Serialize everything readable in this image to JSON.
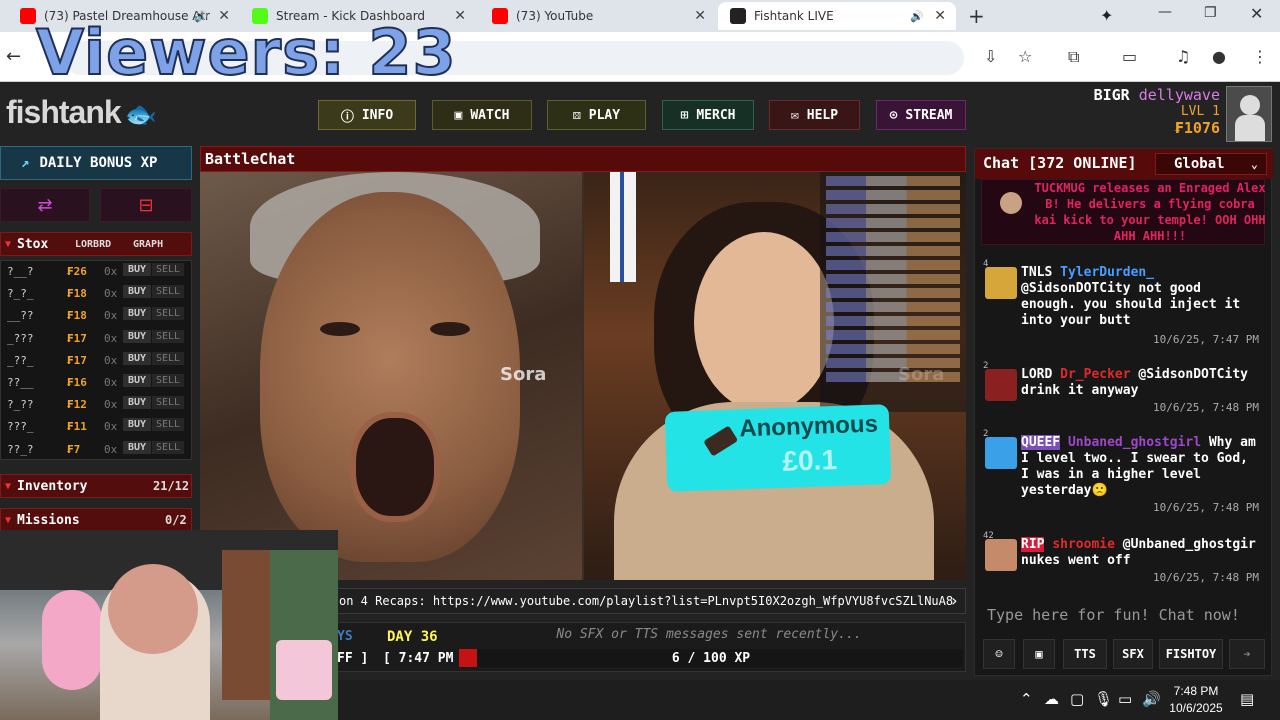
{
  "browser": {
    "tabs": [
      {
        "title": "(73) Pastel Dreamhouse Atr",
        "favicon_color": "#ff0000",
        "active": false,
        "audio": true
      },
      {
        "title": "Stream - Kick Dashboard",
        "favicon_color": "#53fc18",
        "active": false,
        "audio": false
      },
      {
        "title": "(73) YouTube",
        "favicon_color": "#ff0000",
        "active": false,
        "audio": false
      },
      {
        "title": "Fishtank LIVE",
        "favicon_color": "#222222",
        "active": true,
        "audio": true
      }
    ],
    "new_tab": "+"
  },
  "overlay": {
    "viewers": "Viewers: 23"
  },
  "site": {
    "logo": "fishtank",
    "nav": [
      {
        "label": "INFO",
        "icon": "info-icon",
        "glyph": "ⓘ",
        "color": "#3b3a1a",
        "border": "#6d6a32"
      },
      {
        "label": "WATCH",
        "icon": "camera-icon",
        "glyph": "▣",
        "color": "#2e2e16",
        "border": "#5d5b2b"
      },
      {
        "label": "PLAY",
        "icon": "dice-icon",
        "glyph": "⚄",
        "color": "#2e3016",
        "border": "#5b6030"
      },
      {
        "label": "MERCH",
        "icon": "cart-icon",
        "glyph": "🛒",
        "color": "#163026",
        "border": "#2f6048"
      },
      {
        "label": "HELP",
        "icon": "help-icon",
        "glyph": "✉",
        "color": "#3a1515",
        "border": "#6a2a2a"
      },
      {
        "label": "STREAM",
        "icon": "stream-icon",
        "glyph": "⊙",
        "color": "#3a1436",
        "border": "#6b2a64"
      }
    ],
    "user": {
      "tag": "BIGR",
      "name": "dellywave",
      "level": "LVL 1",
      "coins": "₣1076"
    }
  },
  "left": {
    "daily_bonus": "DAILY BONUS XP",
    "stox": {
      "title": "Stox",
      "lorbrd": "LORBRD",
      "graph": "GRAPH"
    },
    "stox_rows": [
      {
        "name": "?__?",
        "price": "₣26",
        "count": "0x",
        "buy": "BUY",
        "sell": "SELL"
      },
      {
        "name": "?_?_",
        "price": "₣18",
        "count": "0x",
        "buy": "BUY",
        "sell": "SELL"
      },
      {
        "name": "__??",
        "price": "₣18",
        "count": "0x",
        "buy": "BUY",
        "sell": "SELL"
      },
      {
        "name": "_???",
        "price": "₣17",
        "count": "0x",
        "buy": "BUY",
        "sell": "SELL"
      },
      {
        "name": "_??_",
        "price": "₣17",
        "count": "0x",
        "buy": "BUY",
        "sell": "SELL"
      },
      {
        "name": "??__",
        "price": "₣16",
        "count": "0x",
        "buy": "BUY",
        "sell": "SELL"
      },
      {
        "name": "?_??",
        "price": "₣12",
        "count": "0x",
        "buy": "BUY",
        "sell": "SELL"
      },
      {
        "name": "???_",
        "price": "₣11",
        "count": "0x",
        "buy": "BUY",
        "sell": "SELL"
      },
      {
        "name": "??_?",
        "price": "₣7",
        "count": "0x",
        "buy": "BUY",
        "sell": "SELL"
      }
    ],
    "inventory": {
      "title": "Inventory",
      "count": "21/12"
    },
    "missions": {
      "title": "Missions",
      "count": "0/2"
    }
  },
  "center": {
    "title": "BattleChat",
    "sora_label": "Sora",
    "donation": {
      "title": "Anonymous",
      "amount": "£0.1"
    },
    "ticker": "on 4 Recaps: https://www.youtube.com/playlist?list=PLnvpt5I0X2ozgh_WfpVYU8fvcSZLlNuA8",
    "status": {
      "ys": "YS",
      "ff": "FF ]",
      "day": "DAY 36",
      "time": "[ 7:47 PM ]",
      "sfx": "No SFX or TTS messages sent recently...",
      "xp": "6 / 100 XP",
      "xp_fraction": 0.06
    }
  },
  "chat": {
    "title": "Chat [372 ONLINE]",
    "room": "Global",
    "system_msg": "TUCKMUG releases an Enraged Alex B! He delivers a flying cobra kai kick to your temple! OOH OHH AHH AHH!!!",
    "messages": [
      {
        "num": "4",
        "badge": "TNLS",
        "badge_color": "#ffffff",
        "badge_bg": "#1b1b1b",
        "user": "TylerDurden_",
        "user_color": "#4a9cff",
        "text": " @SidsonDOTCity not good enough. you should inject it into your butt",
        "time": "10/6/25, 7:47 PM",
        "avatar": "#d6a63a"
      },
      {
        "num": "2",
        "badge": "LORD",
        "badge_color": "#ffffff",
        "badge_bg": "#1b1b1b",
        "user": "Dr_Pecker",
        "user_color": "#e02a2a",
        "text": " @SidsonDOTCity drink it anyway",
        "time": "10/6/25, 7:48 PM",
        "avatar": "#8a2020"
      },
      {
        "num": "2",
        "badge": "QUEEF",
        "badge_color": "#ffffff",
        "badge_bg": "#7b4fb8",
        "user": "Unbaned_ghostgirl",
        "user_color": "#9e48c8",
        "text": " Why am I level two.. I swear to God, I was in a higher level yesterday🙁",
        "time": "10/6/25, 7:48 PM",
        "avatar": "#3aa0e8"
      },
      {
        "num": "42",
        "badge": "RIP",
        "badge_color": "#ffffff",
        "badge_bg": "#d81b3a",
        "user": "shroomie",
        "user_color": "#e02a2a",
        "text": " @Unbaned_ghostgir nukes went off",
        "time": "10/6/25, 7:48 PM",
        "avatar": "#c48a6a"
      }
    ],
    "input_placeholder": "Type here for fun! Chat now!",
    "buttons": {
      "tts": "TTS",
      "sfx": "SFX",
      "fishtoy": "FISHTOY"
    }
  },
  "taskbar": {
    "time": "7:48 PM",
    "date": "10/6/2025"
  }
}
